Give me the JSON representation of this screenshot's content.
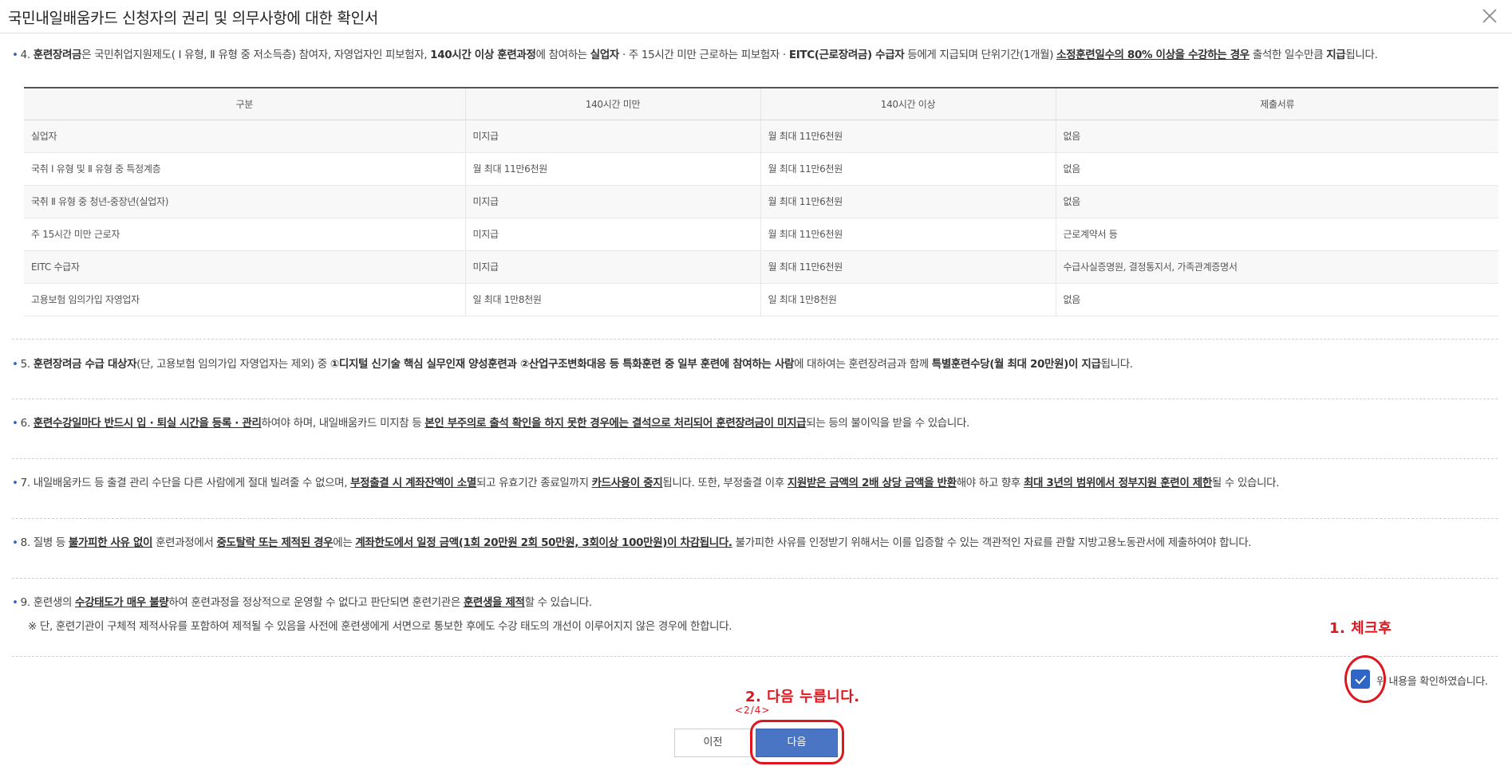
{
  "modal": {
    "title": "국민내일배움카드 신청자의 권리 및 의무사항에 대한 확인서",
    "close_label": "닫기"
  },
  "items": {
    "item4": {
      "num": "4.",
      "p1": "훈련장려금",
      "p2": "은 국민취업지원제도( Ⅰ 유형, Ⅱ 유형 중 저소득층) 참여자, 자영업자인 피보험자, ",
      "p3": "140시간 이상 훈련과정",
      "p4": "에 참여하는 ",
      "p5": "실업자",
      "p6": " · 주 15시간 미만 근로하는 피보험자 · ",
      "p7": "EITC(근로장려금) 수급자",
      "p8": " 등에게 지급되며 단위기간(1개월) ",
      "p9": "소정훈련일수의 80% 이상을 수강하는 경우",
      "p10": " 출석한 일수만큼 ",
      "p11": "지급",
      "p12": "됩니다."
    },
    "item5": {
      "num": "5.",
      "p1": "훈련장려금 수급 대상자",
      "p2": "(단, 고용보험 임의가입 자영업자는 제외) 중 ",
      "p3": "①디지털 신기술 핵심 실무인재 양성훈련과 ②산업구조변화대응 등 특화훈련 중 일부 훈련에 참여하는 사람",
      "p4": "에 대하여는 훈련장려금과 함께 ",
      "p5": "특별훈련수당(월 최대 20만원)이 지급",
      "p6": "됩니다."
    },
    "item6": {
      "num": "6.",
      "p1": "훈련수강일마다 반드시 입 · 퇴실 시간을 등록 · 관리",
      "p2": "하여야 하며, 내일배움카드 미지참 등 ",
      "p3": "본인 부주의로 출석 확인을 하지 못한 경우에는 결석으로 처리되어 훈련장려금이 미지급",
      "p4": "되는 등의 불이익을 받을 수 있습니다."
    },
    "item7": {
      "num": "7.",
      "p1": "내일배움카드 등 출결 관리 수단을 다른 사람에게 절대 빌려줄 수 없으며, ",
      "p2": "부정출결 시 계좌잔액이 소멸",
      "p3": "되고 유효기간 종료일까지 ",
      "p4": "카드사용이 중지",
      "p5": "됩니다. 또한, 부정출결 이후 ",
      "p6": "지원받은 금액의 2배 상당 금액을 반환",
      "p7": "해야 하고 향후 ",
      "p8": "최대 3년의 범위에서 정부지원 훈련이 제한",
      "p9": "될 수 있습니다."
    },
    "item8": {
      "num": "8.",
      "p1": "질병 등 ",
      "p2": "불가피한 사유 없이",
      "p3": " 훈련과정에서 ",
      "p4": "중도탈락 또는 제적된 경우",
      "p5": "에는 ",
      "p6": "계좌한도에서 일정 금액(1회 20만원 2회 50만원, 3회이상 100만원)이 차감됩니다.",
      "p7": " 불가피한 사유를 인정받기 위해서는 이를 입증할 수 있는 객관적인 자료를 관할 지방고용노동관서에 제출하여야 합니다."
    },
    "item9": {
      "num": "9.",
      "p1": "훈련생의 ",
      "p2": "수강태도가 매우 불량",
      "p3": "하여 훈련과정을 정상적으로 운영할 수 없다고 판단되면 훈련기관은 ",
      "p4": "훈련생을 제적",
      "p5": "할 수 있습니다.",
      "note": "※ 단, 훈련기관이 구체적 제적사유를 포함하여 제적될 수 있음을 사전에 훈련생에게 서면으로 통보한 후에도 수강 태도의 개선이 이루어지지 않은 경우에 한합니다."
    }
  },
  "table": {
    "headers": [
      "구분",
      "140시간 미만",
      "140시간 이상",
      "제출서류"
    ],
    "rows": [
      [
        "실업자",
        "미지급",
        "월 최대 11만6천원",
        "없음"
      ],
      [
        "국취 Ⅰ 유형 및 Ⅱ 유형 중 특정계층",
        "월 최대 11만6천원",
        "월 최대 11만6천원",
        "없음"
      ],
      [
        "국취 Ⅱ 유형 중 청년-중장년(실업자)",
        "미지급",
        "월 최대 11만6천원",
        "없음"
      ],
      [
        "주 15시간 미만 근로자",
        "미지급",
        "월 최대 11만6천원",
        "근로계약서 등"
      ],
      [
        "EITC 수급자",
        "미지급",
        "월 최대 11만6천원",
        "수급사실증명원, 결정통지서, 가족관계증명서"
      ],
      [
        "고용보험 임의가입 자영업자",
        "일 최대 1만8천원",
        "일 최대 1만8천원",
        "없음"
      ]
    ]
  },
  "confirm": {
    "checked": true,
    "label": "위 내용을 확인하였습니다."
  },
  "pager": {
    "text": "<2/4>"
  },
  "buttons": {
    "prev": "이전",
    "next": "다음"
  },
  "annotations": {
    "step1": "1. 체크후",
    "step2": "2. 다음 누릅니다.",
    "color": "#e0161f"
  },
  "colors": {
    "accent": "#2f66c6",
    "next_button": "#4a74c4"
  }
}
